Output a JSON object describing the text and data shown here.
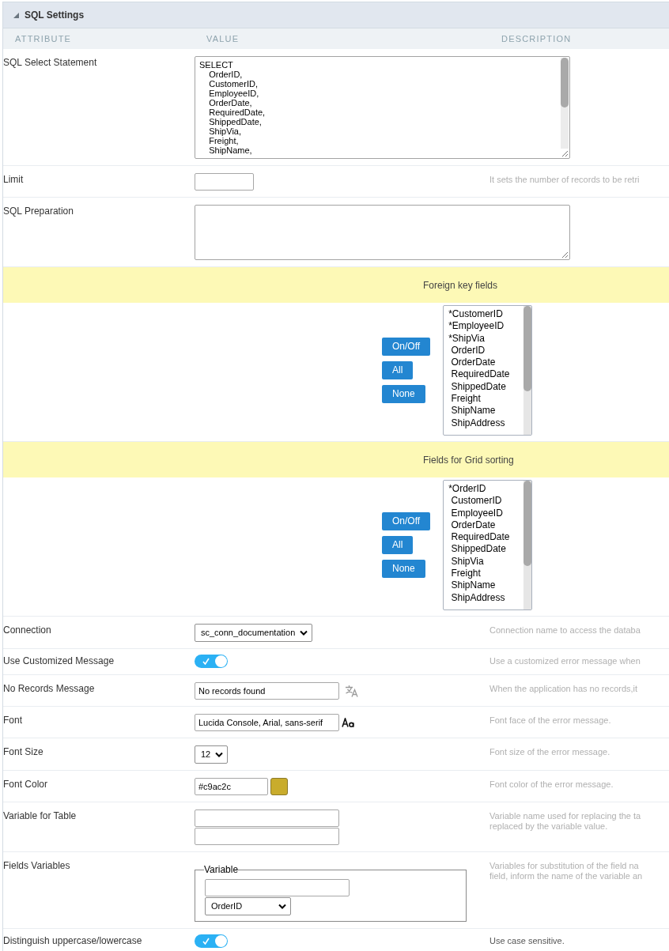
{
  "section": {
    "title": "SQL Settings",
    "expanded": true
  },
  "columns": [
    "ATTRIBUTE",
    "VALUE",
    "DESCRIPTION"
  ],
  "rows": [
    {
      "kind": "textarea",
      "label": "SQL Select Statement",
      "value": "SELECT\n    OrderID,\n    CustomerID,\n    EmployeeID,\n    OrderDate,\n    RequiredDate,\n    ShippedDate,\n    ShipVia,\n    Freight,\n    ShipName,"
    },
    {
      "kind": "text",
      "label": "Limit",
      "description": {
        "lines": [
          "It sets the number of records to be retri"
        ],
        "blurred": true
      }
    },
    {
      "kind": "textarea",
      "label": "SQL Preparation"
    },
    {
      "kind": "band",
      "title": "Foreign key fields"
    },
    {
      "kind": "picker",
      "buttons": [
        "On/Off",
        "All",
        "None"
      ],
      "options": [
        {
          "text": "*CustomerID",
          "selected": false
        },
        {
          "text": "*EmployeeID",
          "selected": false
        },
        {
          "text": "*ShipVia",
          "selected": false
        },
        {
          "text": " OrderID",
          "selected": false
        },
        {
          "text": " OrderDate",
          "selected": false
        },
        {
          "text": " RequiredDate",
          "selected": false
        },
        {
          "text": " ShippedDate",
          "selected": false
        },
        {
          "text": " Freight",
          "selected": false
        },
        {
          "text": " ShipName",
          "selected": false
        },
        {
          "text": " ShipAddress",
          "selected": false
        }
      ]
    },
    {
      "kind": "band",
      "title": "Fields for Grid sorting"
    },
    {
      "kind": "picker",
      "buttons": [
        "On/Off",
        "All",
        "None"
      ],
      "options": [
        {
          "text": "*OrderID",
          "selected": false
        },
        {
          "text": " CustomerID",
          "selected": false
        },
        {
          "text": " EmployeeID",
          "selected": false
        },
        {
          "text": " OrderDate",
          "selected": false
        },
        {
          "text": " RequiredDate",
          "selected": false
        },
        {
          "text": " ShippedDate",
          "selected": false
        },
        {
          "text": " ShipVia",
          "selected": false
        },
        {
          "text": " Freight",
          "selected": false
        },
        {
          "text": " ShipName",
          "selected": false
        },
        {
          "text": " ShipAddress",
          "selected": false
        }
      ]
    },
    {
      "kind": "select",
      "label": "Connection",
      "value": "sc_conn_documentation",
      "description": {
        "lines": [
          "Connection name to access the databa"
        ],
        "blurred": true
      }
    },
    {
      "kind": "toggle",
      "label": "Use Customized Message",
      "on": true,
      "description": {
        "lines": [
          "Use a customized error message when"
        ],
        "blurred": true
      }
    },
    {
      "kind": "translatable_text",
      "label": "No Records Message",
      "value": "No records found",
      "description": {
        "lines": [
          "When the application has no records,it"
        ],
        "blurred": true
      }
    },
    {
      "kind": "font_picker",
      "label": "Font",
      "value": "Lucida Console, Arial, sans-serif",
      "description": {
        "lines": [
          "Font face of the error message."
        ],
        "blurred": true
      }
    },
    {
      "kind": "select",
      "label": "Font Size",
      "value": "12",
      "description": {
        "lines": [
          "Font size of the error message."
        ],
        "blurred": true
      }
    },
    {
      "kind": "color_picker",
      "label": "Font Color",
      "value": "#c9ac2c",
      "color": "#c9ac2c",
      "description": {
        "lines": [
          "Font color of the error message."
        ],
        "blurred": true
      }
    },
    {
      "kind": "multi_text",
      "label": "Variable for Table",
      "fields": [
        {
          "kind": "text"
        },
        {
          "kind": "text"
        }
      ],
      "description": {
        "lines": [
          "Variable name used for replacing the ta",
          "replaced by the variable value."
        ],
        "blurred": true
      }
    },
    {
      "kind": "fieldset",
      "label": "Fields Variables",
      "legend": "Variable",
      "fields": [
        {
          "kind": "text"
        },
        {
          "kind": "select",
          "value": "OrderID"
        }
      ],
      "description": {
        "lines": [
          "Variables for substitution of the field na",
          "field, inform the name of the variable an"
        ],
        "blurred": true
      }
    },
    {
      "kind": "toggle",
      "label": "Distinguish uppercase/lowercase",
      "on": true,
      "description": {
        "lines": [
          "Use case sensitive."
        ],
        "blurred": false
      }
    }
  ]
}
